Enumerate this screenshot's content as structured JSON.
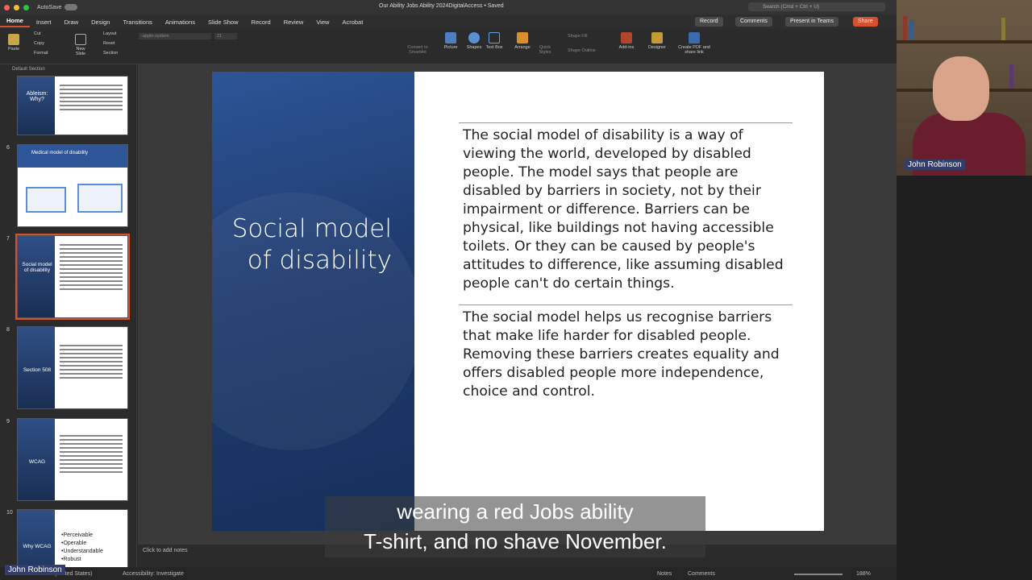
{
  "window": {
    "autosave": "AutoSave",
    "title": "Our Ability Jobs Ability 2024DigitalAccess",
    "saved": "• Saved",
    "search_placeholder": "Search (Cmd + Ctrl + U)"
  },
  "tabs": [
    "Home",
    "Insert",
    "Draw",
    "Design",
    "Transitions",
    "Animations",
    "Slide Show",
    "Record",
    "Review",
    "View",
    "Acrobat"
  ],
  "top_buttons": {
    "record": "Record",
    "comments": "Comments",
    "present_teams": "Present in Teams",
    "share": "Share"
  },
  "ribbon": {
    "paste": "Paste",
    "cut": "Cut",
    "copy": "Copy",
    "format": "Format",
    "new_slide": "New Slide",
    "layout": "Layout",
    "reset": "Reset",
    "section": "Section",
    "font": "-apple-system",
    "size": "21",
    "convert": "Convert to SmartArt",
    "picture": "Picture",
    "shapes": "Shapes",
    "text_box": "Text Box",
    "arrange": "Arrange",
    "quick_styles": "Quick Styles",
    "shape_fill": "Shape Fill",
    "shape_outline": "Shape Outline",
    "addins": "Add-ins",
    "designer": "Designer",
    "create_pdf": "Create PDF and share link"
  },
  "thumbs": {
    "section": "Default Section",
    "items": [
      {
        "num": "",
        "title": "Ableism: Why?"
      },
      {
        "num": "6",
        "title": "Medical model of disability"
      },
      {
        "num": "7",
        "title": "Social model of disability"
      },
      {
        "num": "8",
        "title": "Section 508"
      },
      {
        "num": "9",
        "title": "WCAG"
      },
      {
        "num": "10",
        "title": "Why WCAG",
        "bullets": "•Perceivable\n•Operable\n•Understandable\n•Robust"
      }
    ]
  },
  "slide": {
    "title": "Social model of disability",
    "p1": "The social model of disability is a way of viewing the world, developed by disabled people. The model says that people are disabled by barriers in society, not by their impairment or difference. Barriers can be physical, like buildings not having accessible toilets. Or they can be caused by people's attitudes to difference, like assuming disabled people can't do certain things.",
    "p2": "The social model helps us recognise barriers that make life harder for disabled people. Removing these barriers creates equality and offers disabled people more independence, choice and control."
  },
  "notes": "Click to add notes",
  "status": {
    "lang": "h (United States)",
    "accessibility": "Accessibility: Investigate",
    "notes": "Notes",
    "comments": "Comments",
    "zoom": "188%"
  },
  "webcam": {
    "name": "John Robinson"
  },
  "self_view": {
    "name": "John Robinson"
  },
  "caption": {
    "line1": "wearing a red Jobs ability",
    "line2": "T-shirt, and no shave November."
  }
}
